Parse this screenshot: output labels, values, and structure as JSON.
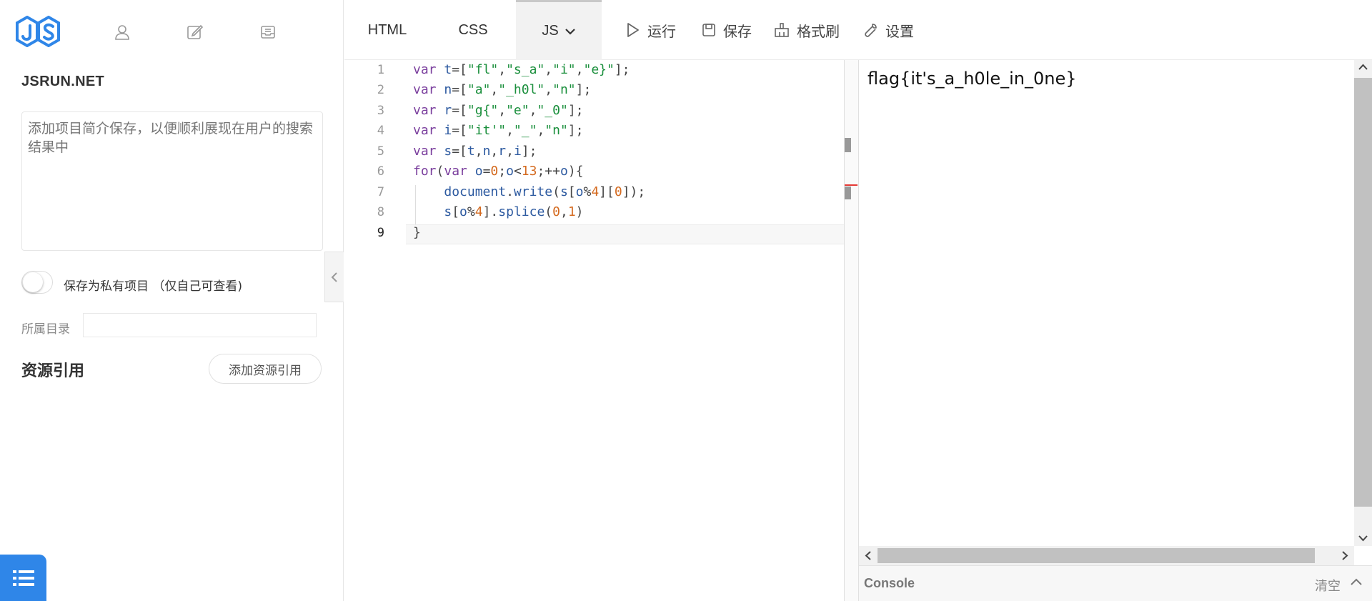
{
  "brand": {
    "name": "JSRUN.NET"
  },
  "sidebar": {
    "description_placeholder": "添加项目简介保存，以便顺利展现在用户的搜索结果中",
    "private_label": "保存为私有项目 （仅自己可查看)",
    "private_enabled": false,
    "directory_label": "所属目录",
    "directory_value": "",
    "resources_title": "资源引用",
    "add_resource_label": "添加资源引用"
  },
  "tabs": [
    {
      "label": "HTML",
      "active": false
    },
    {
      "label": "CSS",
      "active": false
    },
    {
      "label": "JS",
      "active": true
    }
  ],
  "toolbar": {
    "run_label": "运行",
    "save_label": "保存",
    "format_label": "格式刷",
    "settings_label": "设置"
  },
  "editor": {
    "line_numbers": [
      "1",
      "2",
      "3",
      "4",
      "5",
      "6",
      "7",
      "8",
      "9"
    ],
    "current_line": 9,
    "lines": [
      "var t=[\"fl\",\"s_a\",\"i\",\"e}\"];",
      "var n=[\"a\",\"_h0l\",\"n\"];",
      "var r=[\"g{\",\"e\",\"_0\"];",
      "var i=[\"it'\",\"_\",\"n\"];",
      "var s=[t,n,r,i];",
      "for(var o=0;o<13;++o){",
      "    document.write(s[o%4][0]);",
      "    s[o%4].splice(0,1)",
      "}"
    ]
  },
  "preview": {
    "output": "flag{it's_a_h0le_in_0ne}"
  },
  "console": {
    "label": "Console",
    "clear_label": "清空"
  },
  "colors": {
    "accent": "#2f86e8",
    "logo": "#2f86e8",
    "keyword": "#7a3e9d",
    "string": "#1a8f3c",
    "number": "#d46a1f"
  }
}
